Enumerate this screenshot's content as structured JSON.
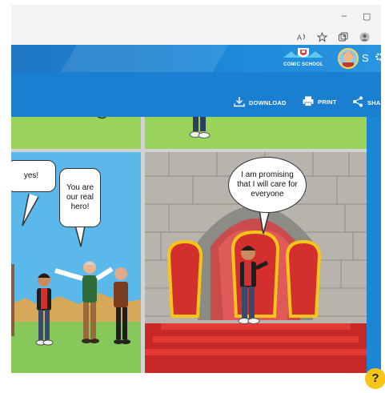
{
  "window": {
    "minimize_glyph": "–",
    "maximize_glyph": "▢"
  },
  "browser_toolbar": {
    "icons": [
      "read-aloud-icon",
      "favorites-icon",
      "collections-icon",
      "profile-icon"
    ]
  },
  "header": {
    "logo_text": "COMIC SCHOOL",
    "user_initial": "S",
    "colors": {
      "header": "#1f77c4",
      "toolbar": "#1b7fd1",
      "help_button": "#f5c518"
    }
  },
  "toolbar": {
    "download_label": "DOWNLOAD",
    "print_label": "PRINT",
    "share_label": "SHA"
  },
  "comic": {
    "panel3": {
      "bubble_left": "yes!",
      "bubble_right": "You are our real hero!"
    },
    "panel4": {
      "bubble": "I am promising that I will care for everyone"
    }
  },
  "help_button": {
    "label": "?"
  }
}
